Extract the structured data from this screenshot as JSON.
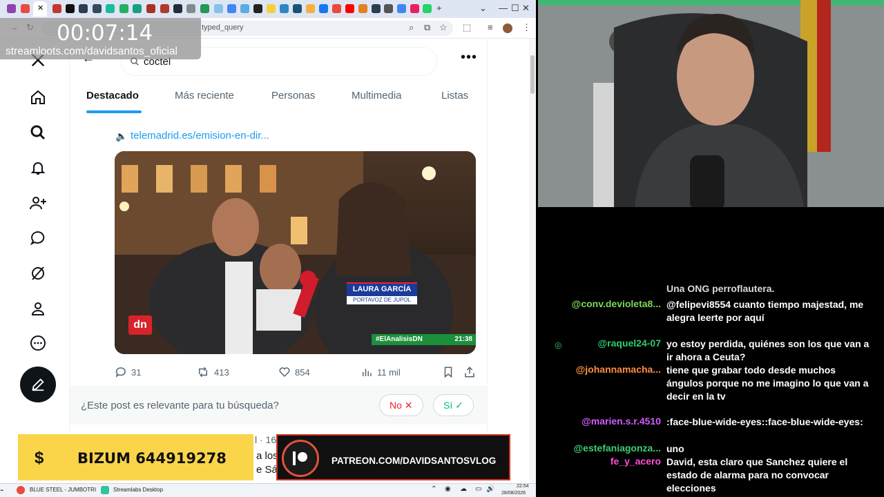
{
  "browser": {
    "url_fragment": "typed_query",
    "window_controls": [
      "⌄",
      "—",
      "☐",
      "✕"
    ]
  },
  "stream_overlay": {
    "timer": "00:07:14",
    "channel": "streamloots.com/davidsantos_oficial",
    "bizum": "BIZUM 644919278",
    "bizum_symbol": "$",
    "patreon": "PATREON.COM/DAVIDSANTOSVLOG"
  },
  "x": {
    "search_query": "coctel",
    "tabs": [
      "Destacado",
      "Más reciente",
      "Personas",
      "Multimedia",
      "Listas"
    ],
    "active_tab": 0,
    "post": {
      "link": "telemadrid.es/emision-en-dir...",
      "video": {
        "name_bar": "LAURA GARCÍA",
        "role_bar": "PORTAVOZ DE JUPOL",
        "hashtag": "#ElAnalisisDN",
        "clock": "21:38",
        "channel_logo": "dn"
      },
      "replies": "31",
      "reposts": "413",
      "likes": "854",
      "views": "11 mil"
    },
    "relevance": {
      "question": "¿Este post es relevante para tu búsqueda?",
      "no": "No",
      "yes": "Sí"
    },
    "next_post": {
      "meta": "l · 16h",
      "line1": "a los",
      "line2": "e Sánc"
    }
  },
  "taskbar": {
    "items": [
      "BLUE STEEL - JUMBOTRI",
      "Streamlabs Desktop"
    ],
    "time": "22:54",
    "date": "28/08/2026"
  },
  "chat": {
    "messages": [
      {
        "user": "@conv.devioleta8...",
        "color": "#7ed957",
        "text": "@felipevi8554 cuanto tiempo majestad, me alegra leerte por aquí"
      },
      {
        "user": "@raquel24-07",
        "color": "#2ecc71",
        "text": "yo estoy perdida, quiénes son los que van a ir ahora a Ceuta?"
      },
      {
        "user": "@johannamacha...",
        "color": "#ff8c42",
        "text": "tiene que grabar todo desde muchos ángulos porque no me imagino lo que van a decir en la tv"
      },
      {
        "user": "@marien.s.r.4510",
        "color": "#d35cff",
        "text": ":face-blue-wide-eyes::face-blue-wide-eyes:"
      },
      {
        "user": "@estefaniagonza...",
        "color": "#3bd16f",
        "text": "uno"
      },
      {
        "user": "fe_y_acero",
        "color": "#ff4fd8",
        "text": "David, esta claro que Sanchez quiere el estado de alarma para no convocar elecciones"
      }
    ],
    "partial_top": "Una ONG perroflautera."
  }
}
